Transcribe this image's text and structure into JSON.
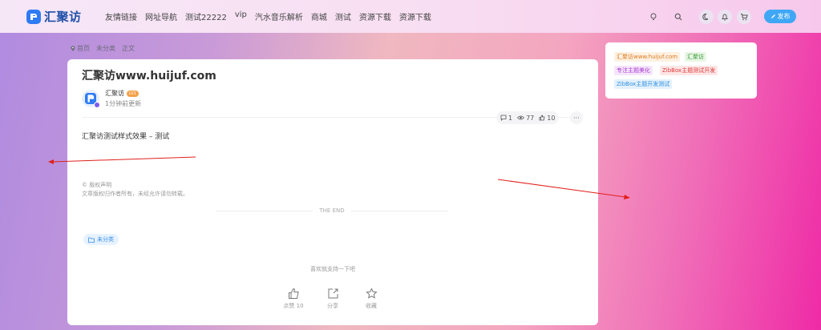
{
  "header": {
    "logo_text": "汇聚访",
    "nav": [
      "友情链接",
      "网址导航",
      "测试22222",
      "vip",
      "汽水音乐解析",
      "商城",
      "测试",
      "资源下载",
      "资源下载"
    ],
    "publish_label": "发布"
  },
  "breadcrumb": {
    "home": "首页",
    "category": "未分类",
    "current": "正文"
  },
  "post": {
    "title": "汇聚访www.huijuf.com",
    "author": "汇聚访",
    "level_badge": "LV1",
    "updated": "1分钟前更新",
    "stats": {
      "comments": "1",
      "views": "77",
      "likes": "10"
    },
    "more": "···",
    "content": "汇聚访测试样式效果 – 测试",
    "copyright_title": "© 版权声明",
    "copyright_text": "文章版权归作者所有，未经允许请勿转载。",
    "end_text": "THE END",
    "category_tag": "未分类",
    "support_text": "喜欢就支持一下吧",
    "actions": {
      "like": "点赞 10",
      "share": "分享",
      "favorite": "收藏"
    }
  },
  "sidebar": {
    "tags": [
      {
        "text": "汇聚访www.huijuf.com",
        "color": "#e07a1f",
        "bg": "#fdf1e2"
      },
      {
        "text": "汇聚访",
        "color": "#3a9a3a",
        "bg": "#e8f6e4"
      },
      {
        "text": "专注主题美化",
        "color": "#a83ad0",
        "bg": "#f5e6fb"
      },
      {
        "text": "ZibBox主题测试开发",
        "color": "#e03a3a",
        "bg": "#fde6e6"
      },
      {
        "text": "ZibBox主题开发测试",
        "color": "#2f8fe0",
        "bg": "#e3f1fd"
      }
    ]
  },
  "colors": {
    "accent": "#3fa7f5",
    "arrow": "#e0201a"
  }
}
